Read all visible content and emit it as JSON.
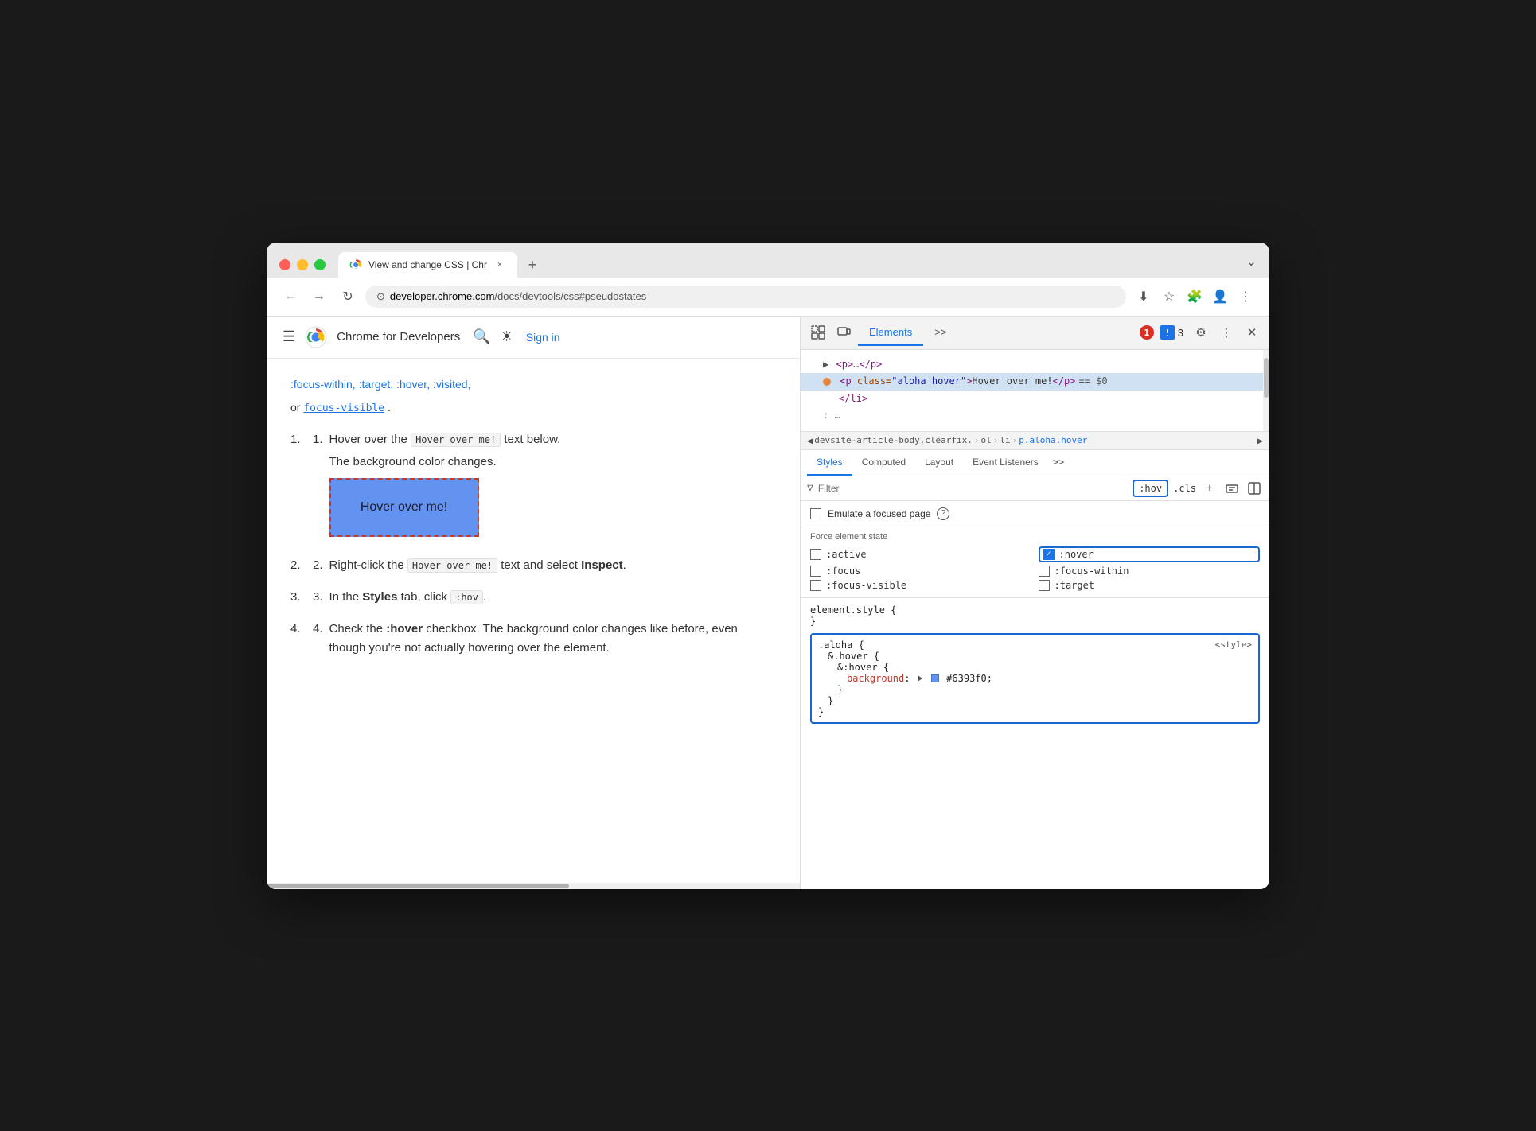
{
  "browser": {
    "tab": {
      "title": "View and change CSS | Chr",
      "close_label": "×",
      "new_tab_label": "+"
    },
    "address": {
      "url_domain": "developer.chrome.com",
      "url_path": "/docs/devtools/css#pseudostates",
      "url_full": "developer.chrome.com/docs/devtools/css#pseudostates"
    },
    "dropdown_icon": "⌄"
  },
  "header": {
    "menu_icon": "☰",
    "site_name": "Chrome for Developers",
    "search_icon": "🔍",
    "theme_icon": "☀",
    "sign_in": "Sign in"
  },
  "page": {
    "fade_text": ":focus-within, :target, :hover, :visited,",
    "focus_visible": "focus-visible",
    "focus_visible_suffix": ".",
    "steps": [
      {
        "num": "1",
        "text_before": "Hover over the",
        "code": "Hover over me!",
        "text_after": "text below. The background color changes."
      },
      {
        "num": "2",
        "text_before": "Right-click the",
        "code": "Hover over me!",
        "text_after": "text and select",
        "bold": "Inspect",
        "text_end": "."
      },
      {
        "num": "3",
        "text_before": "In the",
        "bold1": "Styles",
        "text_mid": "tab, click",
        "code": ":hov",
        "text_end": "."
      },
      {
        "num": "4",
        "text_before": "Check the",
        "bold": ":hover",
        "text_mid": "checkbox. The background color changes like before, even though you're not actually hovering over the element."
      }
    ],
    "hover_box_text": "Hover over me!"
  },
  "devtools": {
    "tabs": [
      "Elements",
      ">>"
    ],
    "active_tab": "Elements",
    "error_count": "1",
    "warning_count": "3",
    "dom": {
      "lines": [
        {
          "text": "▶ <p>…</p>",
          "selected": false
        },
        {
          "text": "<p class=\"aloha hover\">Hover over me!</p> == $0",
          "selected": true,
          "has_dot": true
        },
        {
          "text": "</li>",
          "selected": false
        },
        {
          "text": ": …",
          "selected": false
        }
      ]
    },
    "breadcrumb": {
      "items": [
        {
          "text": "devsite-article-body.clearfix.",
          "active": false
        },
        {
          "text": "ol",
          "active": false
        },
        {
          "text": "li",
          "active": false
        },
        {
          "text": "p.aloha.hover",
          "active": true
        }
      ]
    },
    "styles_tabs": [
      "Styles",
      "Computed",
      "Layout",
      "Event Listeners",
      ">>"
    ],
    "active_styles_tab": "Styles",
    "filter_placeholder": "Filter",
    "hov_badge": ":hov",
    "cls_badge": ".cls",
    "emulate_label": "Emulate a focused page",
    "force_state_label": "Force element state",
    "states": {
      "left": [
        ":active",
        ":focus",
        ":focus-visible"
      ],
      "right": [
        ":hover",
        ":focus-within",
        ":target"
      ]
    },
    "hover_checked": true,
    "css_rules": [
      {
        "selector": "element.style {",
        "body": "}",
        "highlighted": false
      },
      {
        "selector": ".aloha {",
        "nested": [
          {
            "selector": "&.hover {"
          },
          {
            "selector": "&:hover {",
            "body": [
              {
                "property": "background",
                "value": "#6393f0",
                "color": "#6393f0"
              }
            ],
            "close": "}"
          }
        ],
        "close": "}",
        "close2": "}",
        "source": "<style>",
        "highlighted": true
      }
    ]
  }
}
